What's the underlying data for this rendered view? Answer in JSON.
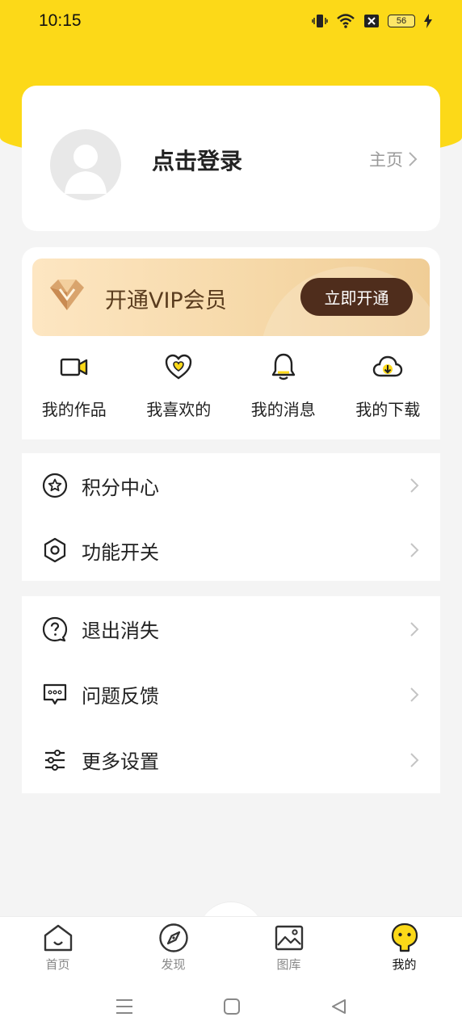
{
  "status_bar": {
    "time": "10:15",
    "battery": "56"
  },
  "profile": {
    "login_text": "点击登录",
    "homepage_label": "主页"
  },
  "vip": {
    "title": "开通VIP会员",
    "button_label": "立即开通"
  },
  "quick_actions": [
    {
      "label": "我的作品",
      "icon": "video-camera-icon"
    },
    {
      "label": "我喜欢的",
      "icon": "heart-icon"
    },
    {
      "label": "我的消息",
      "icon": "bell-icon"
    },
    {
      "label": "我的下载",
      "icon": "cloud-download-icon"
    }
  ],
  "menu_group_1": [
    {
      "label": "积分中心",
      "icon": "star-circle-icon"
    },
    {
      "label": "功能开关",
      "icon": "hexagon-settings-icon"
    }
  ],
  "menu_group_2": [
    {
      "label": "退出消失",
      "icon": "question-circle-icon"
    },
    {
      "label": "问题反馈",
      "icon": "feedback-chat-icon"
    },
    {
      "label": "更多设置",
      "icon": "sliders-icon"
    }
  ],
  "tabs": [
    {
      "label": "首页",
      "icon": "home-icon",
      "active": false
    },
    {
      "label": "发现",
      "icon": "compass-icon",
      "active": false
    },
    {
      "label": "图库",
      "icon": "gallery-icon",
      "active": false
    },
    {
      "label": "我的",
      "icon": "profile-face-icon",
      "active": true
    }
  ],
  "colors": {
    "brand_yellow": "#fcd918",
    "vip_button": "#4f2d1c",
    "vip_text": "#5a3c1e",
    "background": "#f4f4f4"
  }
}
